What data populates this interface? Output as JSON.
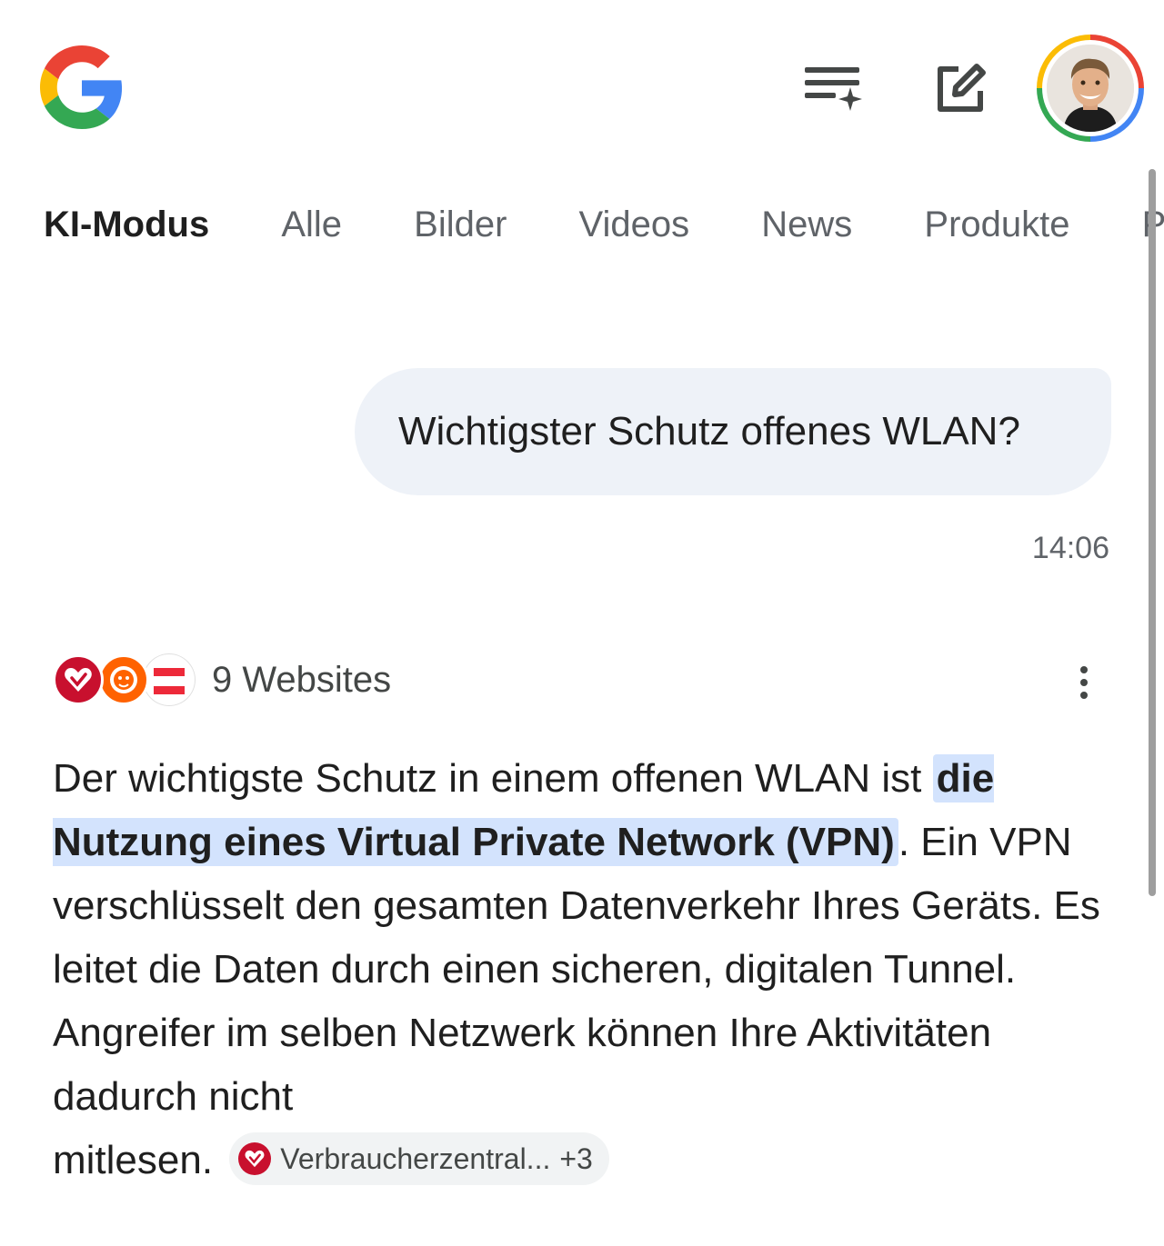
{
  "header": {
    "logo_icon": "google-g-logo",
    "history_icon": "list-sparkle-icon",
    "new_chat_icon": "edit-square-icon",
    "avatar_icon": "profile-photo"
  },
  "tabs": [
    {
      "label": "KI-Modus",
      "active": true
    },
    {
      "label": "Alle"
    },
    {
      "label": "Bilder"
    },
    {
      "label": "Videos"
    },
    {
      "label": "News"
    },
    {
      "label": "Produkte"
    },
    {
      "label": "Pro"
    }
  ],
  "query": {
    "text": "Wichtigster Schutz offenes WLAN?",
    "time": "14:06"
  },
  "sources": {
    "label": "9 Websites",
    "menu_icon": "more-vert-icon"
  },
  "answer": {
    "part1": "Der wichtigste Schutz in einem offenen WLAN ist ",
    "highlight": "die Nutzung eines Virtual Private Network (VPN)",
    "part2": ". Ein VPN verschlüsselt den gesamten Datenverkehr Ihres Geräts. Es leitet die Daten durch einen sicheren, digitalen Tunnel. Angreifer im selben Netzwerk können Ihre Aktivitäten dadurch nicht",
    "part3": "mitlesen. ",
    "citation": {
      "label": "Verbraucherzentral...",
      "more": "+3"
    }
  },
  "colors": {
    "accent_blue": "#4285f4",
    "highlight_bg": "#d3e3fd",
    "bubble_bg": "#eef2f8"
  }
}
